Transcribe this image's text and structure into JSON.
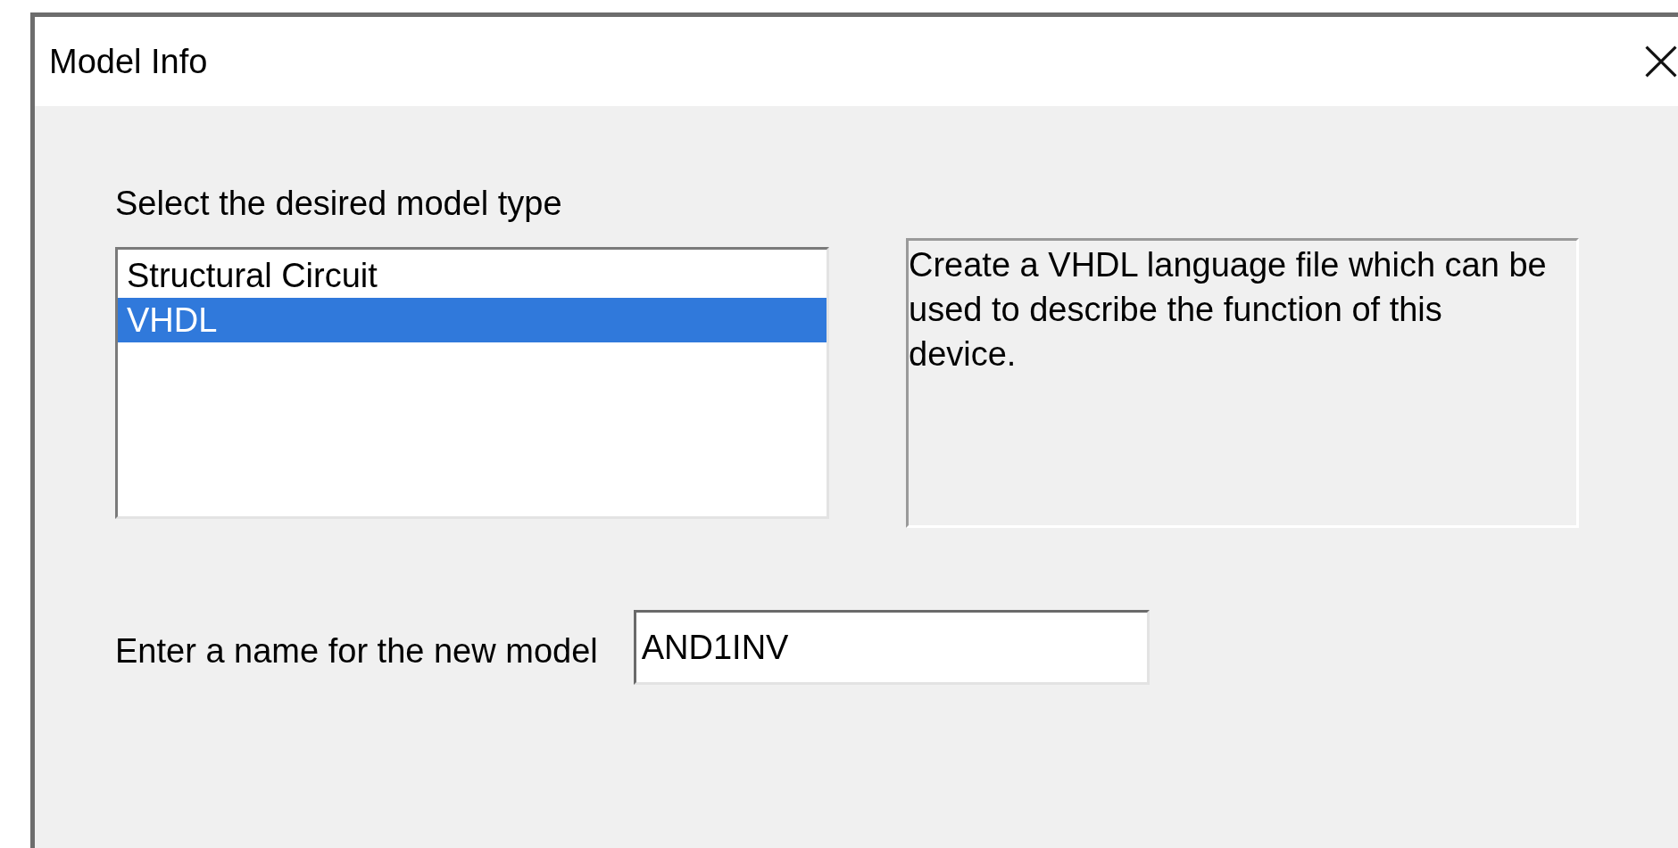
{
  "window": {
    "title": "Model Info"
  },
  "prompt": "Select the desired model type",
  "model_types": [
    {
      "label": "Structural Circuit",
      "selected": false
    },
    {
      "label": "VHDL",
      "selected": true
    }
  ],
  "description": "Create a VHDL language file which can be used to describe the function of this device.",
  "name_field": {
    "label": "Enter a name for the new model",
    "value": "AND1INV"
  }
}
